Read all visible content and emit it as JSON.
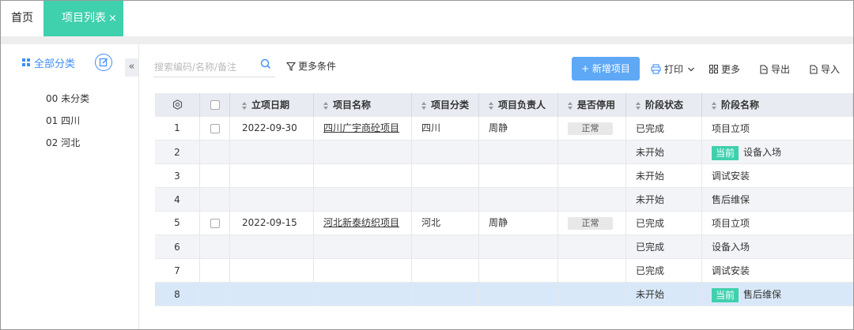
{
  "tabs": {
    "home": "首页",
    "active": "项目列表",
    "close": "×"
  },
  "sidebar": {
    "title": "全部分类",
    "collapse": "«",
    "items": [
      {
        "label": "00 未分类"
      },
      {
        "label": "01 四川"
      },
      {
        "label": "02 河北"
      }
    ]
  },
  "toolbar": {
    "search_placeholder": "搜索编码/名称/备注",
    "more_conditions": "更多条件",
    "new_project": "+ 新增项目",
    "print": "打印",
    "more": "更多",
    "export": "导出",
    "import": "导入"
  },
  "table": {
    "headers": [
      "立项日期",
      "项目名称",
      "项目分类",
      "项目负责人",
      "是否停用",
      "阶段状态",
      "阶段名称"
    ],
    "current_badge": "当前",
    "rows": [
      {
        "no": "1",
        "date": "2022-09-30",
        "name": "四川广宇商砼项目",
        "category": "四川",
        "owner": "周静",
        "disabled": "正常",
        "status": "已完成",
        "stage": "项目立项",
        "current": false
      },
      {
        "no": "2",
        "date": "",
        "name": "",
        "category": "",
        "owner": "",
        "disabled": "",
        "status": "未开始",
        "stage": "设备入场",
        "current": true
      },
      {
        "no": "3",
        "date": "",
        "name": "",
        "category": "",
        "owner": "",
        "disabled": "",
        "status": "未开始",
        "stage": "调试安装",
        "current": false
      },
      {
        "no": "4",
        "date": "",
        "name": "",
        "category": "",
        "owner": "",
        "disabled": "",
        "status": "未开始",
        "stage": "售后维保",
        "current": false
      },
      {
        "no": "5",
        "date": "2022-09-15",
        "name": "河北新泰纺织项目",
        "category": "河北",
        "owner": "周静",
        "disabled": "正常",
        "status": "已完成",
        "stage": "项目立项",
        "current": false
      },
      {
        "no": "6",
        "date": "",
        "name": "",
        "category": "",
        "owner": "",
        "disabled": "",
        "status": "已完成",
        "stage": "设备入场",
        "current": false
      },
      {
        "no": "7",
        "date": "",
        "name": "",
        "category": "",
        "owner": "",
        "disabled": "",
        "status": "已完成",
        "stage": "调试安装",
        "current": false
      },
      {
        "no": "8",
        "date": "",
        "name": "",
        "category": "",
        "owner": "",
        "disabled": "",
        "status": "未开始",
        "stage": "售后维保",
        "current": true
      }
    ]
  },
  "colors": {
    "accent_green": "#3fd0ad",
    "primary_blue": "#5ea8f5",
    "link_blue": "#3e8ef7",
    "header_bg": "#e8ebf1",
    "selected_row": "#d9e8f8"
  }
}
